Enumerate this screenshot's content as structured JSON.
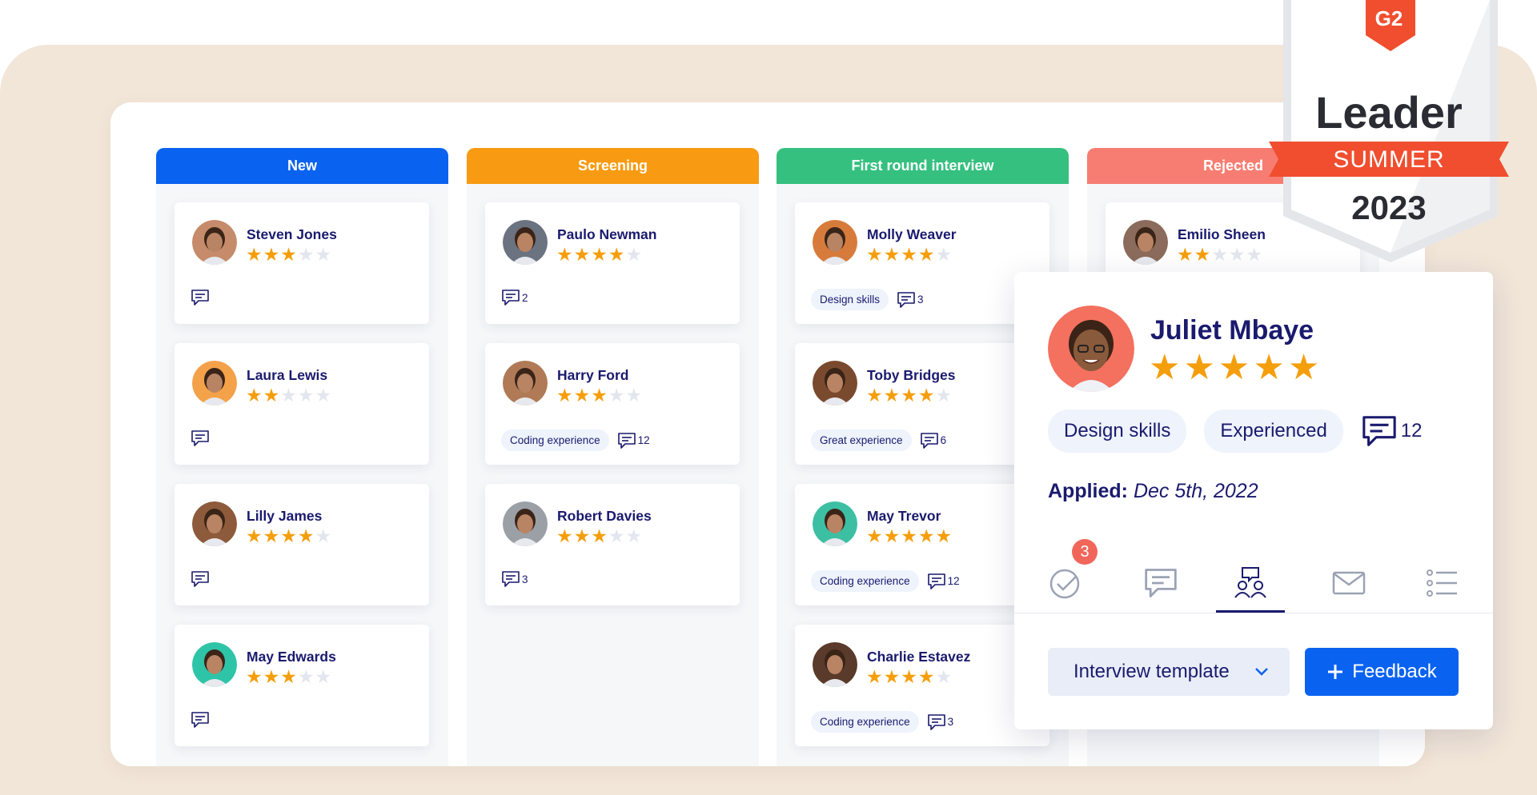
{
  "columns": [
    {
      "title": "New",
      "color": "#0a62f0"
    },
    {
      "title": "Screening",
      "color": "#f89b12"
    },
    {
      "title": "First round interview",
      "color": "#35c07f"
    },
    {
      "title": "Rejected",
      "color": "#f77d72"
    }
  ],
  "cards": {
    "new": [
      {
        "name": "Steven Jones",
        "rating": 3,
        "tag": "",
        "comments": ""
      },
      {
        "name": "Laura Lewis",
        "rating": 2,
        "tag": "",
        "comments": ""
      },
      {
        "name": "Lilly James",
        "rating": 4,
        "tag": "",
        "comments": ""
      },
      {
        "name": "May Edwards",
        "rating": 3,
        "tag": "",
        "comments": ""
      }
    ],
    "screening": [
      {
        "name": "Paulo Newman",
        "rating": 4,
        "tag": "",
        "comments": "2"
      },
      {
        "name": "Harry Ford",
        "rating": 3,
        "tag": "Coding experience",
        "comments": "12"
      },
      {
        "name": "Robert Davies",
        "rating": 3,
        "tag": "",
        "comments": "3"
      }
    ],
    "interview": [
      {
        "name": "Molly Weaver",
        "rating": 4,
        "tag": "Design skills",
        "comments": "3"
      },
      {
        "name": "Toby Bridges",
        "rating": 4,
        "tag": "Great experience",
        "comments": "6"
      },
      {
        "name": "May Trevor",
        "rating": 5,
        "tag": "Coding experience",
        "comments": "12"
      },
      {
        "name": "Charlie Estavez",
        "rating": 4,
        "tag": "Coding experience",
        "comments": "3"
      }
    ],
    "rejected": [
      {
        "name": "Emilio Sheen",
        "rating": 2,
        "tag": "",
        "comments": ""
      }
    ]
  },
  "detail": {
    "name": "Juliet Mbaye",
    "rating": 5,
    "tags": [
      "Design skills",
      "Experienced"
    ],
    "comments": "12",
    "applied_label": "Applied:",
    "applied_date": "Dec 5th, 2022",
    "tabs": [
      "check-icon",
      "comment-icon",
      "interview-icon",
      "mail-icon",
      "list-icon"
    ],
    "active_tab": "interview-icon",
    "badge": "3",
    "template_label": "Interview template",
    "feedback_label": "Feedback"
  },
  "badge_g2": {
    "brand": "G2",
    "title": "Leader",
    "season": "SUMMER",
    "year": "2023"
  }
}
